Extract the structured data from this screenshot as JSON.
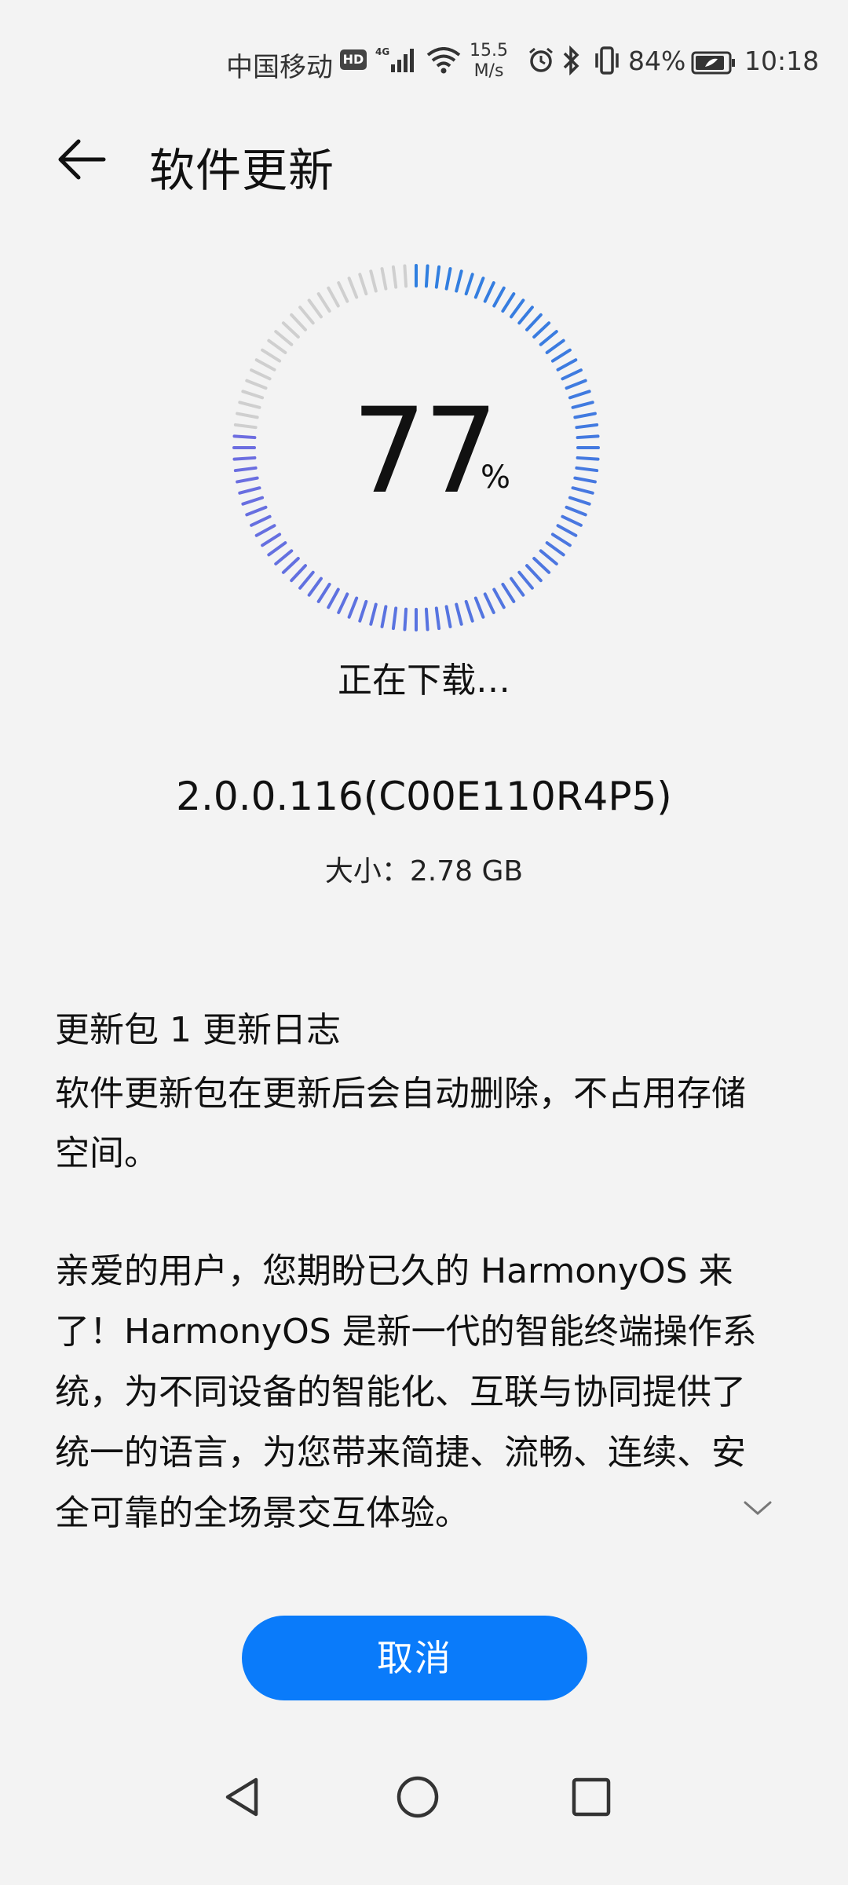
{
  "status_bar": {
    "carrier": "中国移动",
    "hd": "HD",
    "network": "4G",
    "speed_value": "15.5",
    "speed_unit": "M/s",
    "battery": "84%",
    "time": "10:18"
  },
  "header": {
    "title": "软件更新"
  },
  "progress": {
    "percent": 77,
    "percent_text": "77",
    "percent_sign": "%",
    "status": "正在下载…"
  },
  "package": {
    "version": "2.0.0.116(C00E110R4P5)",
    "size": "大小：2.78 GB"
  },
  "changelog": {
    "title": "更新包 1 更新日志",
    "notice": "软件更新包在更新后会自动删除，不占用存储空间。",
    "description": "亲爱的用户，您期盼已久的 HarmonyOS 来了！HarmonyOS 是新一代的智能终端操作系统，为不同设备的智能化、互联与协同提供了统一的语言，为您带来简捷、流畅、连续、安全可靠的全场景交互体验。"
  },
  "actions": {
    "cancel_label": "取消"
  },
  "colors": {
    "accent": "#0a7bfa",
    "ring_blue": "#2f7fe0",
    "ring_purple": "#6d6de0",
    "ring_gray": "#cfcfcf"
  }
}
